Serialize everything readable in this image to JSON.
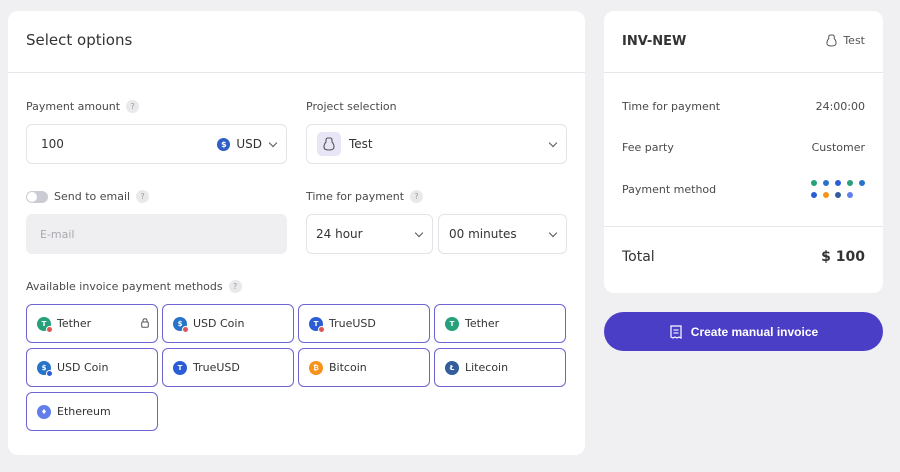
{
  "left_panel": {
    "title": "Select options",
    "payment_amount": {
      "label": "Payment amount",
      "value": "100",
      "currency": "USD",
      "currency_symbol": "$"
    },
    "project_selection": {
      "label": "Project selection",
      "value": "Test"
    },
    "send_to_email": {
      "label": "Send to email",
      "placeholder": "E-mail",
      "enabled": false
    },
    "time_for_payment": {
      "label": "Time for payment",
      "hours": "24 hour",
      "minutes": "00 minutes"
    },
    "methods_label": "Available invoice payment methods",
    "help_glyph": "?",
    "methods": [
      {
        "name": "Tether",
        "symbol": "T",
        "color": "#26a17b",
        "badge": "#e05555",
        "locked": true
      },
      {
        "name": "USD Coin",
        "symbol": "$",
        "color": "#2775ca",
        "badge": "#e05555",
        "locked": false
      },
      {
        "name": "TrueUSD",
        "symbol": "T",
        "color": "#2b5ed6",
        "badge": "#e05555",
        "locked": false
      },
      {
        "name": "Tether",
        "symbol": "T",
        "color": "#26a17b",
        "badge": "",
        "locked": false
      },
      {
        "name": "USD Coin",
        "symbol": "$",
        "color": "#2775ca",
        "badge": "#2b5ed6",
        "locked": false
      },
      {
        "name": "TrueUSD",
        "symbol": "T",
        "color": "#2b5ed6",
        "badge": "",
        "locked": false
      },
      {
        "name": "Bitcoin",
        "symbol": "₿",
        "color": "#f7931a",
        "badge": "",
        "locked": false
      },
      {
        "name": "Litecoin",
        "symbol": "Ł",
        "color": "#345d9d",
        "badge": "",
        "locked": false
      },
      {
        "name": "Ethereum",
        "symbol": "♦",
        "color": "#627eea",
        "badge": "",
        "locked": false
      }
    ]
  },
  "summary": {
    "invoice_id": "INV-NEW",
    "project": "Test",
    "time_label": "Time for payment",
    "time_value": "24:00:00",
    "fee_label": "Fee party",
    "fee_value": "Customer",
    "method_label": "Payment method",
    "method_dots": [
      "#26a17b",
      "#2775ca",
      "#2b5ed6",
      "#26a17b",
      "#2775ca",
      "#2b5ed6",
      "#f7931a",
      "#345d9d",
      "#627eea"
    ],
    "total_label": "Total",
    "total_value": "$ 100"
  },
  "create_button": {
    "label": "Create manual invoice"
  },
  "colors": {
    "accent": "#4b3ec6",
    "border_selected": "#6d64cf"
  }
}
